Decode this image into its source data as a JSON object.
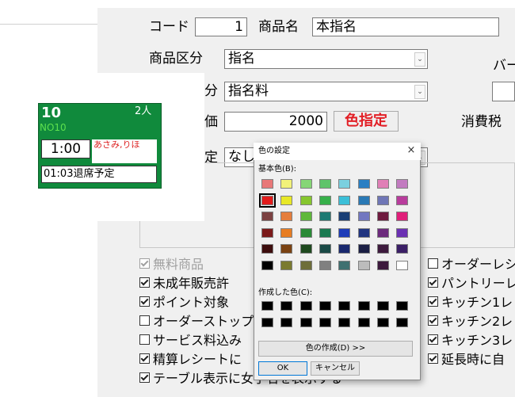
{
  "form": {
    "code_label": "コード",
    "code_value": "1",
    "name_label": "商品名",
    "name_value": "本指名",
    "category_label": "商品区分",
    "category_value": "指名",
    "category2_label_partial": "分",
    "category2_value": "指名料",
    "price_label_partial": "価",
    "price_value": "2000",
    "color_button_label": "色指定",
    "tax_label": "消費税",
    "bar_label_partial": "バー",
    "setting_label_partial": "定",
    "setting_value_partial": "なし",
    "checkboxes_left": [
      {
        "label": "無料商品",
        "checked": true,
        "disabled": true
      },
      {
        "label": "未成年販売許",
        "checked": true,
        "disabled": false
      },
      {
        "label": "ポイント対象",
        "checked": true,
        "disabled": false
      },
      {
        "label": "オーダーストップ",
        "checked": false,
        "disabled": false
      },
      {
        "label": "サービス料込み",
        "checked": false,
        "disabled": false
      },
      {
        "label": "精算レシートに",
        "checked": true,
        "disabled": false
      },
      {
        "label": "テーブル表示に女子名を表示する",
        "checked": true,
        "disabled": false
      }
    ],
    "checkboxes_right": [
      {
        "label": "オーダーレシ",
        "checked": false
      },
      {
        "label": "パントリーレ",
        "checked": true
      },
      {
        "label": "キッチン1レ",
        "checked": true
      },
      {
        "label": "キッチン2レ",
        "checked": true
      },
      {
        "label": "キッチン3レ",
        "checked": true
      },
      {
        "label": "延長時に自",
        "checked": true
      }
    ]
  },
  "preview": {
    "table_number": "10",
    "persons": "2人",
    "code": "NO10",
    "time": "1:00",
    "names": "あさみ,りほ",
    "status": "01:03退席予定",
    "tile_color": "#108a3c"
  },
  "color_dialog": {
    "title": "色の設定",
    "close_glyph": "×",
    "basic_colors_label": "基本色(B):",
    "custom_colors_label": "作成した色(C):",
    "define_button": "色の作成(D) >>",
    "ok_button": "OK",
    "cancel_button": "キャンセル",
    "basic_colors": [
      [
        "#ff8080",
        "#ffff80",
        "#80ff80",
        "#00ff80",
        "#80ffff",
        "#0080ff",
        "#ff80c0",
        "#ff80ff"
      ],
      [
        "#ff0000",
        "#ffff00",
        "#80ff00",
        "#00ff40",
        "#00ffff",
        "#0080c0",
        "#8080c0",
        "#ff00ff"
      ],
      [
        "#804040",
        "#ff8040",
        "#00ff00",
        "#008080",
        "#004080",
        "#8080ff",
        "#800040",
        "#ff0080"
      ],
      [
        "#800000",
        "#ff8000",
        "#008000",
        "#008040",
        "#0000ff",
        "#0000a0",
        "#800080",
        "#8000ff"
      ],
      [
        "#400000",
        "#804000",
        "#004000",
        "#004040",
        "#000080",
        "#000040",
        "#400040",
        "#400080"
      ],
      [
        "#000000",
        "#808000",
        "#808040",
        "#808080",
        "#408080",
        "#c0c0c0",
        "#400040",
        "#ffffff"
      ]
    ],
    "basic_colors_display": [
      [
        "#e87878",
        "#f2f27a",
        "#86d676",
        "#5fc46a",
        "#7ad0df",
        "#2a7fc3",
        "#e07fb6",
        "#c27bc0"
      ],
      [
        "#e21b1b",
        "#e8e827",
        "#86c62e",
        "#37b04a",
        "#3bbfd8",
        "#2a79b5",
        "#6f76b6",
        "#b83c9c"
      ],
      [
        "#7b4141",
        "#e57e3d",
        "#5fb83a",
        "#1d7a73",
        "#1a3f76",
        "#7277c0",
        "#6f1b3f",
        "#e0207a"
      ],
      [
        "#7b1a1a",
        "#e77d23",
        "#2a8a36",
        "#1a7a50",
        "#1d3cb8",
        "#203480",
        "#6c2a7c",
        "#6b31b3"
      ],
      [
        "#3d0d0d",
        "#7a4212",
        "#1f4a1f",
        "#1a4a46",
        "#19286e",
        "#1b1f44",
        "#3d1a3d",
        "#3b1f66"
      ],
      [
        "#000000",
        "#7a7a30",
        "#6e6e3a",
        "#808080",
        "#3f7070",
        "#bcbcbc",
        "#3d1a3d",
        "#ffffff"
      ]
    ],
    "selected_basic": [
      1,
      0
    ],
    "custom_colors": [
      [
        "#000000",
        "#000000",
        "#000000",
        "#000000",
        "#000000",
        "#000000",
        "#000000",
        "#000000"
      ],
      [
        "#000000",
        "#000000",
        "#000000",
        "#000000",
        "#000000",
        "#000000",
        "#000000",
        "#000000"
      ]
    ]
  }
}
